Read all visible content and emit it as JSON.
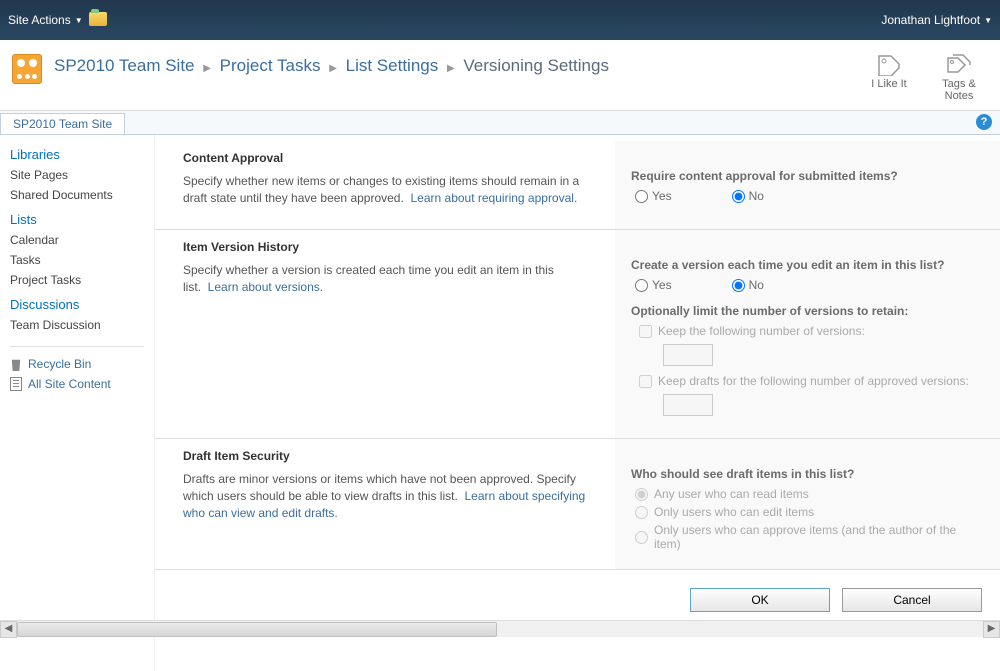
{
  "ribbon": {
    "site_actions": "Site Actions",
    "user": "Jonathan Lightfoot"
  },
  "breadcrumb": {
    "site": "SP2010 Team Site",
    "list": "Project Tasks",
    "settings": "List Settings",
    "current": "Versioning Settings"
  },
  "header_actions": {
    "like": "I Like It",
    "tags": "Tags & Notes"
  },
  "tab": {
    "site": "SP2010 Team Site"
  },
  "quicklaunch": {
    "libraries": "Libraries",
    "site_pages": "Site Pages",
    "shared_docs": "Shared Documents",
    "lists": "Lists",
    "calendar": "Calendar",
    "tasks": "Tasks",
    "project_tasks": "Project Tasks",
    "discussions": "Discussions",
    "team_discussion": "Team Discussion",
    "recycle_bin": "Recycle Bin",
    "all_content": "All Site Content"
  },
  "sections": {
    "approval": {
      "title": "Content Approval",
      "desc": "Specify whether new items or changes to existing items should remain in a draft state until they have been approved.",
      "link": "Learn about requiring approval.",
      "question": "Require content approval for submitted items?",
      "yes": "Yes",
      "no": "No"
    },
    "history": {
      "title": "Item Version History",
      "desc": "Specify whether a version is created each time you edit an item in this list.",
      "link": "Learn about versions.",
      "question": "Create a version each time you edit an item in this list?",
      "yes": "Yes",
      "no": "No",
      "limit_label": "Optionally limit the number of versions to retain:",
      "keep_versions": "Keep the following number of versions:",
      "keep_drafts": "Keep drafts for the following number of approved versions:"
    },
    "draft": {
      "title": "Draft Item Security",
      "desc": "Drafts are minor versions or items which have not been approved. Specify which users should be able to view drafts in this list.",
      "link": "Learn about specifying who can view and edit drafts.",
      "question": "Who should see draft items in this list?",
      "opt1": "Any user who can read items",
      "opt2": "Only users who can edit items",
      "opt3": "Only users who can approve items (and the author of the item)"
    }
  },
  "buttons": {
    "ok": "OK",
    "cancel": "Cancel"
  }
}
